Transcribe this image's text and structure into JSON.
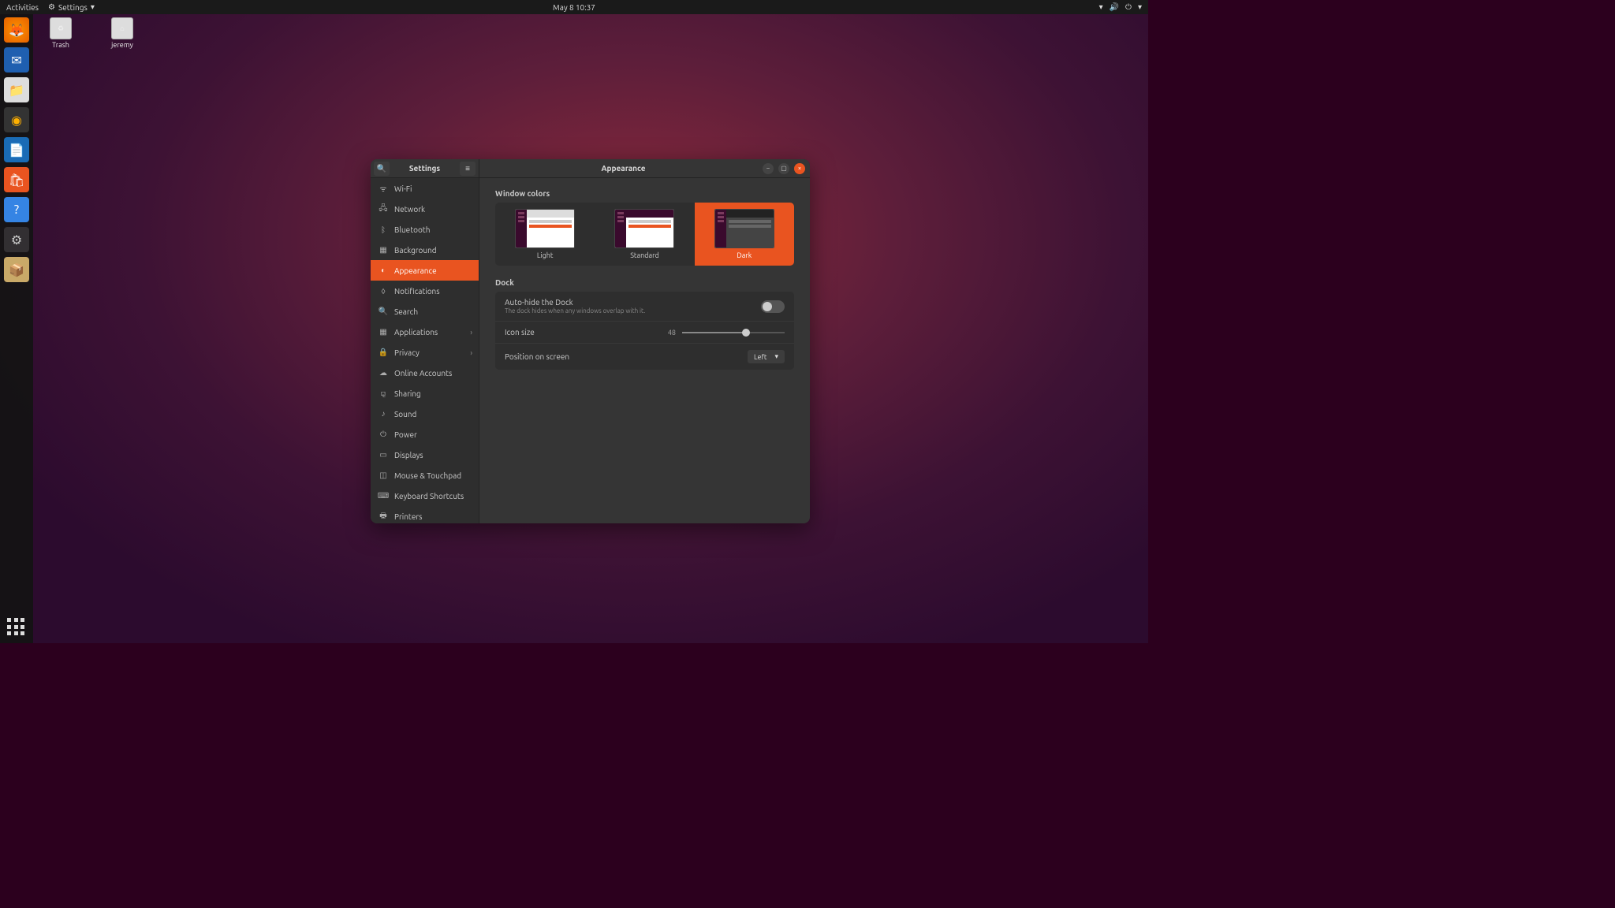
{
  "topbar": {
    "activities": "Activities",
    "app_name": "Settings",
    "datetime": "May 8  10:37"
  },
  "desktop_icons": [
    {
      "label": "Trash",
      "icon": "trash"
    },
    {
      "label": "jeremy",
      "icon": "home"
    }
  ],
  "dock_apps": [
    "firefox",
    "thunderbird",
    "files",
    "rhythmbox",
    "writer",
    "software",
    "help",
    "settings",
    "archive"
  ],
  "window": {
    "title_left": "Settings",
    "title_right": "Appearance"
  },
  "sidebar": {
    "items": [
      {
        "label": "Wi-Fi",
        "icon": "wifi"
      },
      {
        "label": "Network",
        "icon": "network"
      },
      {
        "label": "Bluetooth",
        "icon": "bluetooth"
      },
      {
        "label": "Background",
        "icon": "background"
      },
      {
        "label": "Appearance",
        "icon": "appearance",
        "selected": true
      },
      {
        "label": "Notifications",
        "icon": "bell"
      },
      {
        "label": "Search",
        "icon": "search"
      },
      {
        "label": "Applications",
        "icon": "apps",
        "chevron": true
      },
      {
        "label": "Privacy",
        "icon": "lock",
        "chevron": true
      },
      {
        "label": "Online Accounts",
        "icon": "cloud"
      },
      {
        "label": "Sharing",
        "icon": "share"
      },
      {
        "label": "Sound",
        "icon": "sound"
      },
      {
        "label": "Power",
        "icon": "power"
      },
      {
        "label": "Displays",
        "icon": "display"
      },
      {
        "label": "Mouse & Touchpad",
        "icon": "mouse"
      },
      {
        "label": "Keyboard Shortcuts",
        "icon": "keyboard"
      },
      {
        "label": "Printers",
        "icon": "printer"
      }
    ]
  },
  "appearance": {
    "window_colors_title": "Window colors",
    "themes": [
      {
        "label": "Light",
        "style": "light"
      },
      {
        "label": "Standard",
        "style": "standard"
      },
      {
        "label": "Dark",
        "style": "dark",
        "selected": true
      }
    ],
    "dock_title": "Dock",
    "autohide_label": "Auto-hide the Dock",
    "autohide_sub": "The dock hides when any windows overlap with it.",
    "autohide_on": false,
    "icon_size_label": "Icon size",
    "icon_size_value": "48",
    "icon_size_pct": 62,
    "position_label": "Position on screen",
    "position_value": "Left"
  }
}
